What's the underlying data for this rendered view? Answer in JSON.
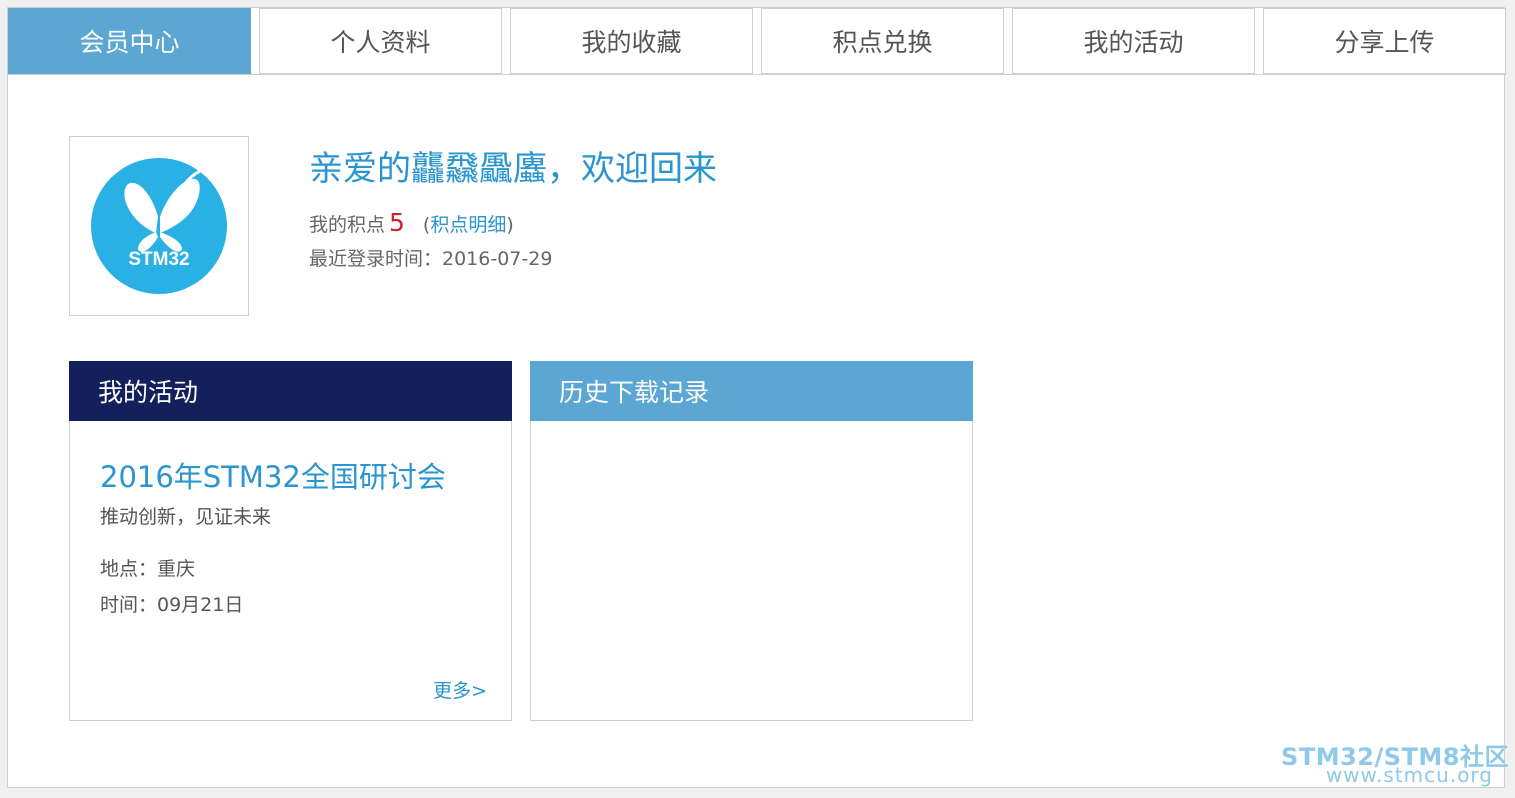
{
  "tabs": [
    {
      "label": "会员中心",
      "active": true
    },
    {
      "label": "个人资料",
      "active": false
    },
    {
      "label": "我的收藏",
      "active": false
    },
    {
      "label": "积点兑换",
      "active": false
    },
    {
      "label": "我的活动",
      "active": false
    },
    {
      "label": "分享上传",
      "active": false
    }
  ],
  "profile": {
    "avatar_text": "STM32",
    "avatar_icon": "butterfly-icon",
    "welcome": "亲爱的龘飝飍蠯，欢迎回来",
    "points_label": "我的积点",
    "points_value": "5",
    "paren_open": "(",
    "points_detail_link": "积点明细",
    "paren_close": ")",
    "last_login": "最近登录时间：2016-07-29"
  },
  "activity_panel": {
    "title": "我的活动",
    "event_title": "2016年STM32全国研讨会",
    "event_subtitle": "推动创新，见证未来",
    "location": "地点：重庆",
    "time": "时间：09月21日",
    "more_link": "更多>"
  },
  "download_panel": {
    "title": "历史下载记录"
  },
  "watermark": {
    "line1": "STM32/STM8社区",
    "line2": "www.stmcu.org"
  },
  "colors": {
    "accent": "#5ba6d3",
    "link": "#2a95cf",
    "dark_header": "#13205b",
    "points": "#c9252b",
    "avatar_circle": "#29b1e6"
  }
}
